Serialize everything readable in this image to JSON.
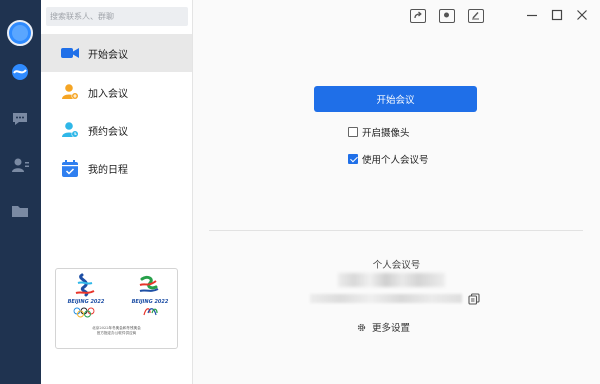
{
  "search": {
    "placeholder": "搜索联系人、群聊"
  },
  "menu": {
    "items": [
      {
        "label": "开始会议",
        "icon": "video-camera-icon"
      },
      {
        "label": "加入会议",
        "icon": "add-user-icon"
      },
      {
        "label": "预约会议",
        "icon": "schedule-user-icon"
      },
      {
        "label": "我的日程",
        "icon": "calendar-icon"
      }
    ]
  },
  "banner": {
    "logo_left": "BEIJING 2022",
    "logo_right": "BEIJING 2022",
    "caption_line1": "北京2022年冬奥会和冬残奥会",
    "caption_line2": "官方指定办公软件供应商"
  },
  "main": {
    "start_button": "开始会议",
    "camera_option": "开启摄像头",
    "camera_checked": false,
    "personal_id_option": "使用个人会议号",
    "personal_id_checked": true,
    "personal_id_label": "个人会议号",
    "more_settings": "更多设置"
  },
  "colors": {
    "rail": "#1f3350",
    "accent": "#1f6fe8"
  }
}
